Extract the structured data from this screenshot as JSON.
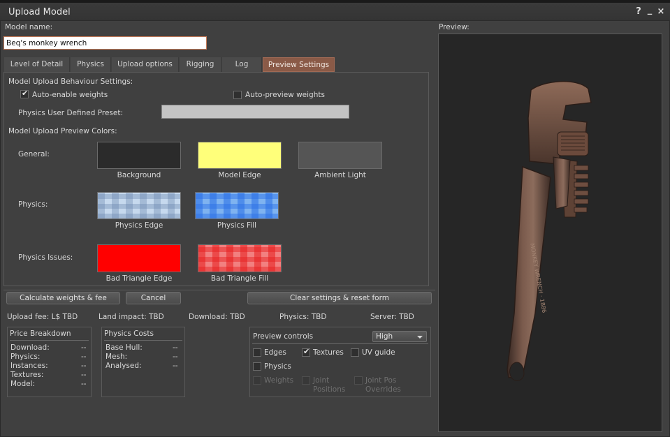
{
  "window": {
    "title": "Upload Model",
    "help_glyph": "?",
    "minimize_glyph": "_",
    "close_glyph": "×"
  },
  "model_name": {
    "label": "Model name:",
    "value": "Beq's monkey wrench"
  },
  "tabs": [
    {
      "label": "Level of Detail"
    },
    {
      "label": "Physics"
    },
    {
      "label": "Upload options"
    },
    {
      "label": "Rigging"
    },
    {
      "label": "Log"
    },
    {
      "label": "Preview Settings",
      "active": true
    }
  ],
  "preview_settings": {
    "behaviour_heading": "Model Upload Behaviour Settings:",
    "auto_enable_weights": {
      "label": "Auto-enable weights",
      "checked": true
    },
    "auto_preview_weights": {
      "label": "Auto-preview weights",
      "checked": false
    },
    "physics_preset_label": "Physics User Defined Preset:",
    "colors_heading": "Model Upload Preview Colors:",
    "rows": {
      "general": "General:",
      "physics": "Physics:",
      "physics_issues": "Physics Issues:"
    },
    "swatches": {
      "background": {
        "label": "Background",
        "color": "#2b2b2b"
      },
      "model_edge": {
        "label": "Model Edge",
        "color": "#ffff7a"
      },
      "ambient_light": {
        "label": "Ambient Light",
        "color": "#555555"
      },
      "physics_edge": {
        "label": "Physics Edge",
        "color": "#c6d9ee"
      },
      "physics_fill": {
        "label": "Physics Fill",
        "color": "#7fb3f0"
      },
      "bad_triangle_edge": {
        "label": "Bad Triangle Edge",
        "color": "#ff0000"
      },
      "bad_triangle_fill": {
        "label": "Bad Triangle Fill",
        "color": "#f28080"
      }
    }
  },
  "buttons": {
    "calculate": "Calculate weights & fee",
    "cancel": "Cancel",
    "clear": "Clear settings & reset form"
  },
  "summary": {
    "upload_fee": "Upload fee: L$ TBD",
    "land_impact": "Land impact: TBD",
    "download": "Download: TBD",
    "physics": "Physics: TBD",
    "server": "Server: TBD"
  },
  "price_breakdown": {
    "title": "Price Breakdown",
    "rows": [
      {
        "label": "Download:",
        "value": "--"
      },
      {
        "label": "Physics:",
        "value": "--"
      },
      {
        "label": "Instances:",
        "value": "--"
      },
      {
        "label": "Textures:",
        "value": "--"
      },
      {
        "label": "Model:",
        "value": "--"
      }
    ]
  },
  "physics_costs": {
    "title": "Physics Costs",
    "rows": [
      {
        "label": "Base Hull:",
        "value": "--"
      },
      {
        "label": "Mesh:",
        "value": "--"
      },
      {
        "label": "Analysed:",
        "value": "--"
      }
    ]
  },
  "preview_controls": {
    "label": "Preview controls",
    "quality": "High",
    "edges": {
      "label": "Edges",
      "checked": false
    },
    "textures": {
      "label": "Textures",
      "checked": true
    },
    "uv_guide": {
      "label": "UV guide",
      "checked": false
    },
    "physics": {
      "label": "Physics",
      "checked": false
    },
    "weights": {
      "label": "Weights",
      "checked": false
    },
    "joint_positions": {
      "label_line1": "Joint",
      "label_line2": "Positions",
      "checked": false
    },
    "joint_pos_overrides": {
      "label_line1": "Joint Pos",
      "label_line2": "Overrides",
      "checked": false
    }
  },
  "preview": {
    "label": "Preview:",
    "engraving": "MONKEY WRENCH · 1886",
    "background": "#262626"
  }
}
